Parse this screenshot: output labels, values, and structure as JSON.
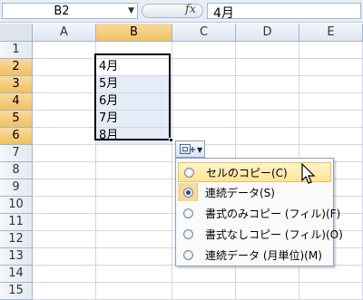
{
  "formula_bar": {
    "name_box": "B2",
    "fx_label": "fx",
    "formula_value": "4月"
  },
  "columns": [
    "A",
    "B",
    "C",
    "D",
    "E"
  ],
  "rows": [
    "1",
    "2",
    "3",
    "4",
    "5",
    "6",
    "7",
    "8",
    "9",
    "10",
    "11",
    "12",
    "13",
    "14",
    "15"
  ],
  "cells": [
    "4月",
    "5月",
    "6月",
    "7月",
    "8月"
  ],
  "autofill_menu": {
    "items": [
      {
        "label": "セルのコピー(C)"
      },
      {
        "label": "連続データ(S)"
      },
      {
        "label": "書式のみコピー (フィル)(F)"
      },
      {
        "label": "書式なしコピー (フィル)(O)"
      },
      {
        "label": "連続データ (月単位)(M)"
      }
    ],
    "selected_option": "連続データ(S)",
    "hovered_option": "セルのコピー(C)"
  }
}
